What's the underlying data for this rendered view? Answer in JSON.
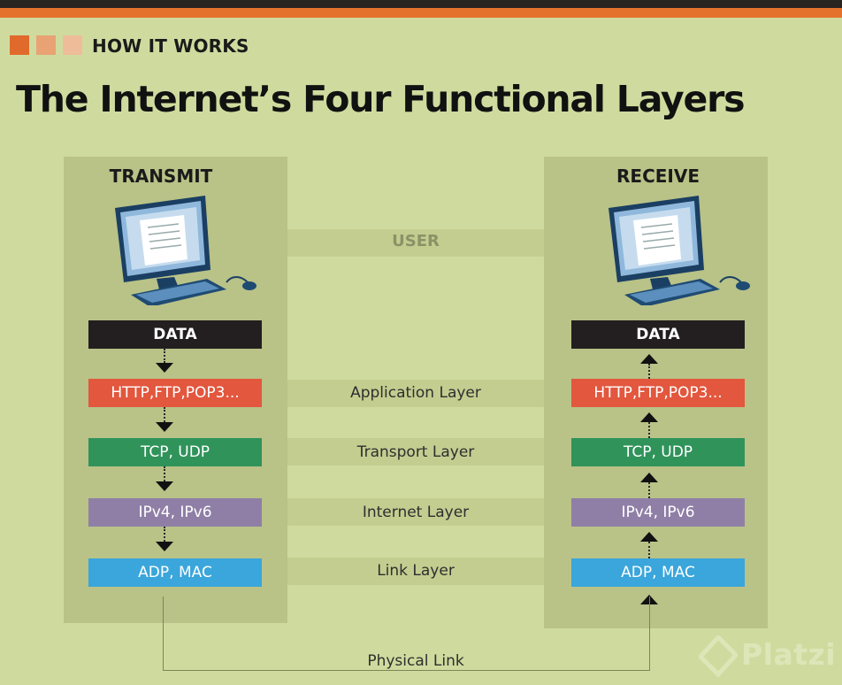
{
  "header": {
    "kicker": "HOW IT WORKS",
    "title": "The Internet’s Four Functional Layers",
    "square_colors": [
      "#e06a2c",
      "#e8a273",
      "#efbc9a"
    ]
  },
  "columns": {
    "transmit": {
      "heading": "TRANSMIT",
      "boxes": [
        "DATA",
        "HTTP,FTP,POP3...",
        "TCP, UDP",
        "IPv4, IPv6",
        "ADP, MAC"
      ],
      "arrow_direction": "down"
    },
    "receive": {
      "heading": "RECEIVE",
      "boxes": [
        "DATA",
        "HTTP,FTP,POP3...",
        "TCP, UDP",
        "IPv4, IPv6",
        "ADP, MAC"
      ],
      "arrow_direction": "up"
    }
  },
  "bands": {
    "user": "USER",
    "application": "Application Layer",
    "transport": "Transport Layer",
    "internet": "Internet Layer",
    "link": "Link Layer"
  },
  "physical_link": "Physical Link",
  "watermark": "Platzi",
  "colors": {
    "background": "#cfdb9e",
    "panel": "#b9c287",
    "data": "#231f20",
    "application": "#e2573e",
    "transport": "#2f935a",
    "internet": "#8f7fa6",
    "link": "#3aa6db",
    "accent": "#e4722c"
  },
  "icons": [
    "computer-icon",
    "arrow-down-icon",
    "arrow-up-icon",
    "platzi-logo-icon"
  ]
}
